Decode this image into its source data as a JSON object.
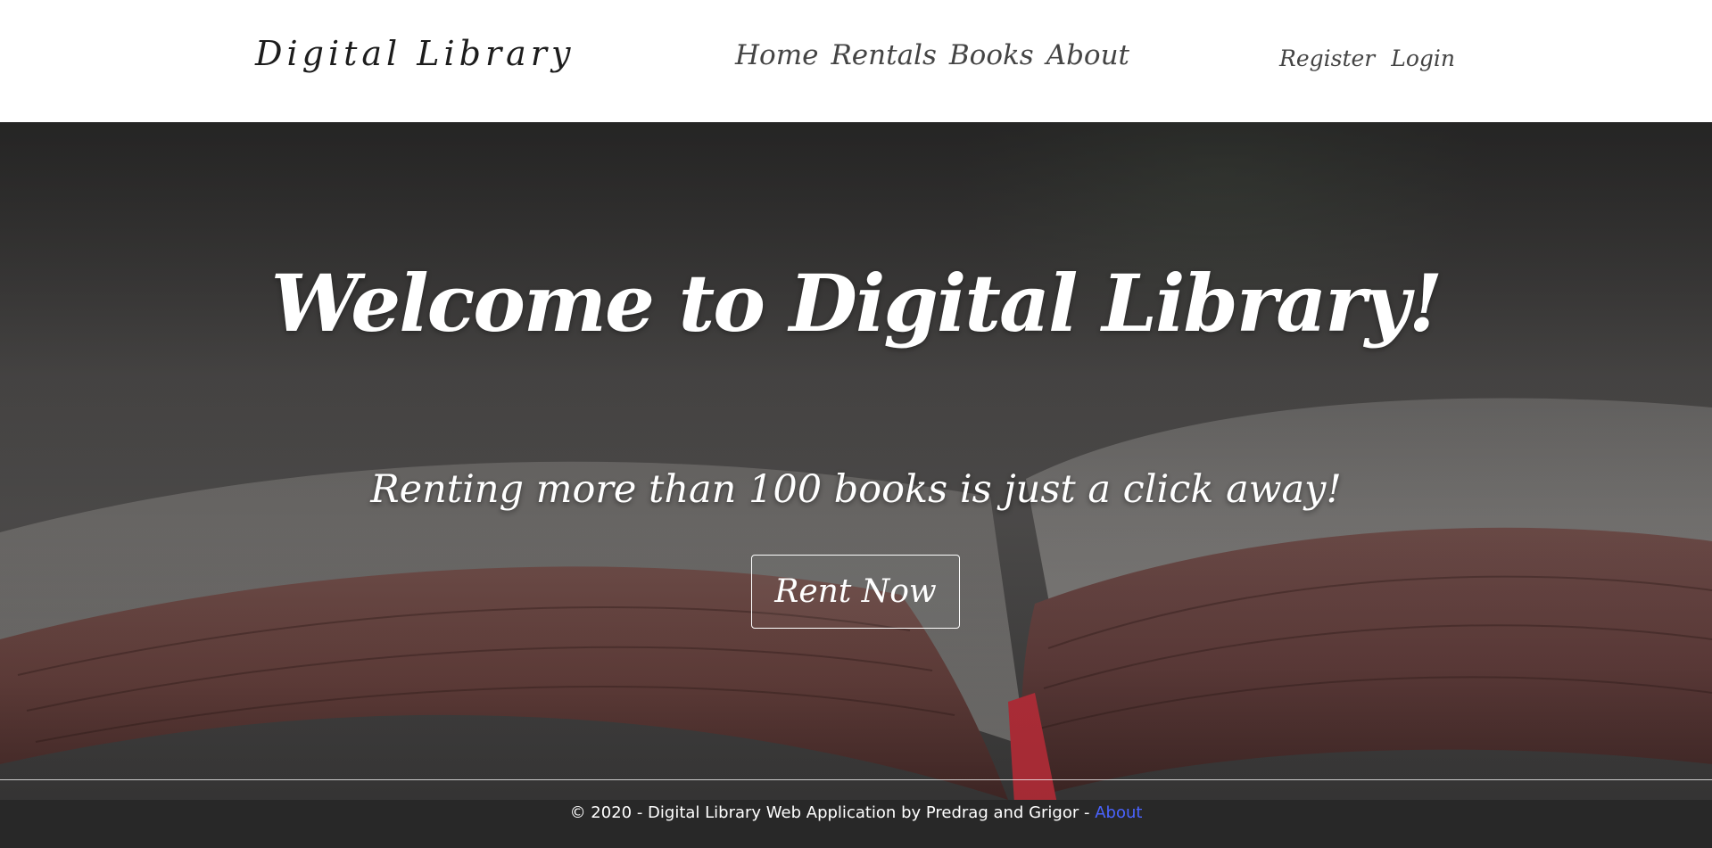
{
  "navbar": {
    "brand": "Digital Library",
    "links": [
      "Home",
      "Rentals",
      "Books",
      "About"
    ],
    "auth": {
      "register": "Register",
      "login": "Login"
    }
  },
  "hero": {
    "title": "Welcome to Digital Library!",
    "subtitle": "Renting more than 100 books is just a click away!",
    "button_label": "Rent Now"
  },
  "footer": {
    "text": "© 2020 - Digital Library Web Application by Predrag and Grigor - ",
    "link_label": "About"
  },
  "colors": {
    "navbar_bg": "#ffffff",
    "nav_text": "#444444",
    "hero_text": "#ffffff",
    "footer_link": "#4a63ff"
  }
}
